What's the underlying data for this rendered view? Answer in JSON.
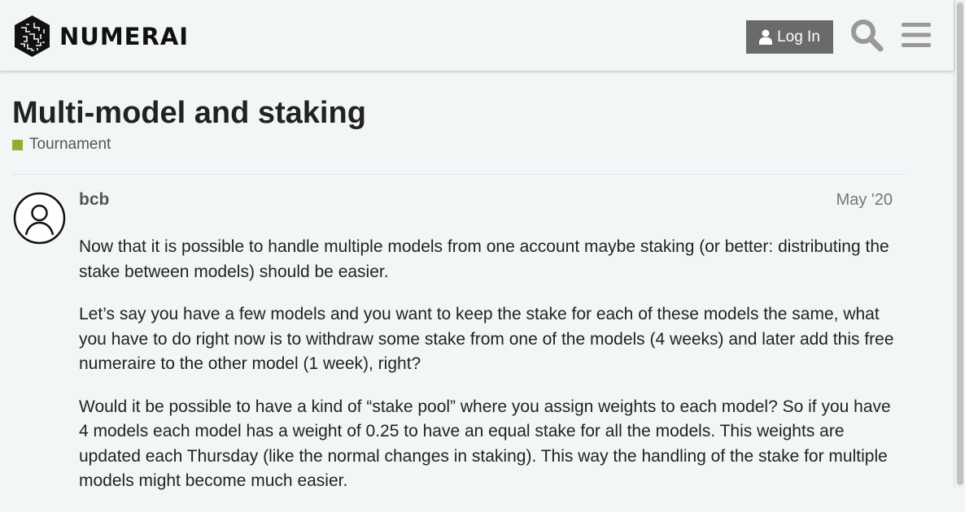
{
  "header": {
    "logo_text": "NUMERAI",
    "login_label": "Log In"
  },
  "topic": {
    "title": "Multi-model and staking",
    "category": "Tournament",
    "category_color": "#8fad2e"
  },
  "post": {
    "username": "bcb",
    "date": "May '20",
    "paragraphs": [
      "Now that it is possible to handle multiple models from one account maybe staking (or better: distributing the stake between models) should be easier.",
      "Let’s say you have a few models and you want to keep the stake for each of these models the same, what you have to do right now is to withdraw some stake from one of the models (4 weeks) and later add this free numeraire to the other model (1 week), right?",
      "Would it be possible to have a kind of “stake pool” where you assign weights to each model? So if you have 4 models each model has a weight of 0.25 to have an equal stake for all the models. This weights are updated each Thursday (like the normal changes in staking). This way the handling of the stake for multiple models might become much easier."
    ]
  },
  "icons": {
    "logo": "numerai-logo-icon",
    "user": "user-icon",
    "search": "search-icon",
    "menu": "hamburger-menu-icon",
    "avatar": "default-avatar-icon"
  }
}
